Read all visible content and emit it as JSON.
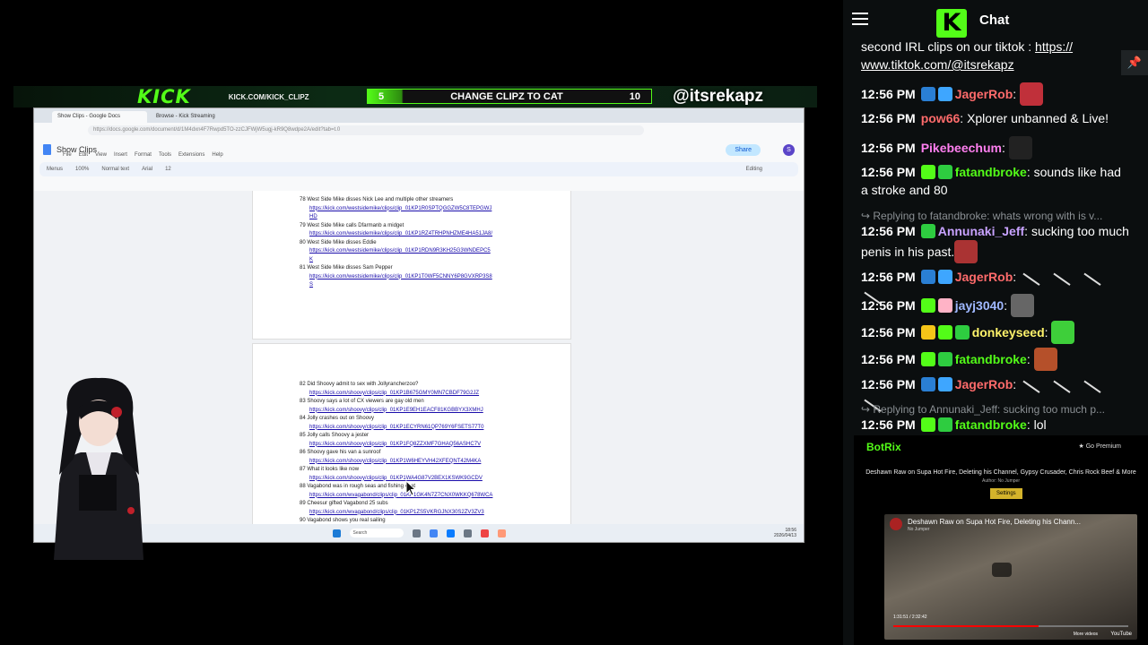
{
  "stream": {
    "overlay": {
      "logo": "KICK",
      "url": "KICK.COM/KICK_CLIPZ",
      "goal_left": "5",
      "goal_text": "CHANGE CLIPZ TO CAT",
      "goal_right": "10",
      "handle": "@itsrekapz"
    },
    "browser": {
      "tabs": [
        "Show Clips - Google Docs",
        "Browse - Kick Streaming"
      ],
      "url": "https://docs.google.com/document/d/1M4dxn4F7Rwpd5TO-zzCJFWjW5ugj-kR9Q8wdpe2A/edit?tab=t.0",
      "doc_title": "Show Clips",
      "menu": [
        "File",
        "Edit",
        "View",
        "Insert",
        "Format",
        "Tools",
        "Extensions",
        "Help"
      ],
      "toolbar": [
        "Menus",
        "100%",
        "Normal text",
        "Arial",
        "12",
        "Editing"
      ],
      "share_label": "Share",
      "avatar": "S",
      "page1_lines": [
        {
          "text": "78 West Side Mike disses Nick Lee and multiple other streamers",
          "link": false
        },
        {
          "text": "https://kick.com/westsidemike/clips/clip_01KP1R0SPTQGGZW5C8TEPGWJ",
          "link": true
        },
        {
          "text": "HD",
          "link": true
        },
        {
          "text": "79 West Side Mike calls Dfarmanb a midget",
          "link": false
        },
        {
          "text": "https://kick.com/westsidemike/clips/clip_01KP1RZ4TRHPNHZME4HA51JA8/",
          "link": true
        },
        {
          "text": "80 West Side Mike disses Eddie",
          "link": false
        },
        {
          "text": "https://kick.com/westsidemike/clips/clip_01KP1RDN9R3KH25G3WNDEPC5",
          "link": true
        },
        {
          "text": "K",
          "link": true
        },
        {
          "text": "81 West Side Mike disses Sam Pepper",
          "link": false
        },
        {
          "text": "https://kick.com/westsidemike/clips/clip_01KP1T0WF5CNNY6P8GVXRP3S8",
          "link": true
        },
        {
          "text": "S",
          "link": true
        }
      ],
      "page2_lines": [
        {
          "text": "82 Did Shoovy admit to sex with Jollyrancherzoo?",
          "link": false
        },
        {
          "text": "https://kick.com/shoovy/clips/clip_01KP1B675GMY0MN7CBDF79G2JZ",
          "link": true
        },
        {
          "text": "83 Shoovy says a lot of CX viewers are gay old men",
          "link": false
        },
        {
          "text": "https://kick.com/shoovy/clips/clip_01KP1E9EH1EACF81KGBBYX3XMHJ",
          "link": true
        },
        {
          "text": "84 Jolly crashes out on Shoovy",
          "link": false
        },
        {
          "text": "https://kick.com/shoovy/clips/clip_01KP1ECYRN61QP769Y6FSETS77T0",
          "link": true
        },
        {
          "text": "85 Jolly calls Shoovy a jester",
          "link": false
        },
        {
          "text": "https://kick.com/shoovy/clips/clip_01KP1FQ8ZZXMF7GHAQ56ASHC7V",
          "link": true
        },
        {
          "text": "86 Shoovy gave his van a sunroof",
          "link": false
        },
        {
          "text": "https://kick.com/shoovy/clips/clip_01KP1W6HEYVH42XFEQNT42M4KA",
          "link": true
        },
        {
          "text": "87 What it looks like now",
          "link": false
        },
        {
          "text": "https://kick.com/shoovy/clips/clip_01KP1WA4G87V2BEX1KSWK9GCDV",
          "link": true
        },
        {
          "text": "88 Vagabond was in rough seas and fishing chat",
          "link": false
        },
        {
          "text": "https://kick.com/wvagabond/clips/clip_01KP1GK4N7Z7CNX0WKKQ678WCA",
          "link": true
        },
        {
          "text": "89 Cheesur gifted Vagabond 25 subs",
          "link": false
        },
        {
          "text": "https://kick.com/wvagabond/clips/clip_01KP1ZS5VKRGJNX30S2ZV3ZV3",
          "link": true
        },
        {
          "text": "90 Vagabond shows you real sailing",
          "link": false
        }
      ],
      "taskbar": {
        "search": "Search",
        "time": "18:56",
        "date": "2026/04/13"
      }
    }
  },
  "chat": {
    "title": "Chat",
    "logo": "K",
    "pin": "📌",
    "top_text_1": "second IRL clips on our tiktok : ",
    "top_link_1": "https://",
    "top_link_2": "www.tiktok.com/@itsrekapz",
    "messages": [
      {
        "time": "12:56 PM",
        "user": "JagerRob",
        "color": "#ff6b6b",
        "text": "",
        "badges": [
          "#2a7fd4",
          "#3ea6ff"
        ],
        "emote": "#c0303a"
      },
      {
        "time": "12:56 PM",
        "user": "pow66",
        "color": "#ff6b6b",
        "text": "Xplorer unbanned & Live!",
        "badges": [],
        "emote": ""
      },
      {
        "time": "12:56 PM",
        "user": "Pikebeechum",
        "color": "#ff7ff0",
        "text": "",
        "badges": [],
        "emote": "#222"
      },
      {
        "time": "12:56 PM",
        "user": "fatandbroke",
        "color": "#53fc18",
        "text": "sounds like had a stroke and 80",
        "badges": [
          "#53fc18",
          "#2ecc40"
        ],
        "emote": ""
      },
      {
        "time": "",
        "user": "",
        "color": "",
        "text": "Replying to fatandbroke: whats wrong with is v...",
        "badges": [],
        "emote": "",
        "reply": true
      },
      {
        "time": "12:56 PM",
        "user": "Annunaki_Jeff",
        "color": "#c8a2ff",
        "text": "sucking too much penis in his past.",
        "badges": [
          "#2ecc40"
        ],
        "emote": "#a33"
      },
      {
        "time": "12:56 PM",
        "user": "JagerRob",
        "color": "#ff6b6b",
        "text": "",
        "badges": [
          "#2a7fd4",
          "#3ea6ff"
        ],
        "emote": "",
        "slashes": 4
      },
      {
        "time": "12:56 PM",
        "user": "jayj3040",
        "color": "#9fb8ff",
        "text": "",
        "badges": [
          "#53fc18",
          "#ffb3c6"
        ],
        "emote": "#666"
      },
      {
        "time": "12:56 PM",
        "user": "donkeyseed",
        "color": "#fff36b",
        "text": "",
        "badges": [
          "#f5c518",
          "#53fc18",
          "#2ecc40"
        ],
        "emote": "#3ecf3a"
      },
      {
        "time": "12:56 PM",
        "user": "fatandbroke",
        "color": "#53fc18",
        "text": "",
        "badges": [
          "#53fc18",
          "#2ecc40"
        ],
        "emote": "#b5502a"
      },
      {
        "time": "12:56 PM",
        "user": "JagerRob",
        "color": "#ff6b6b",
        "text": "",
        "badges": [
          "#2a7fd4",
          "#3ea6ff"
        ],
        "emote": "",
        "slashes": 4
      },
      {
        "time": "",
        "user": "",
        "color": "",
        "text": "Replying to Annunaki_Jeff: sucking too much p...",
        "badges": [],
        "emote": "",
        "reply": true
      },
      {
        "time": "12:56 PM",
        "user": "fatandbroke",
        "color": "#53fc18",
        "text": "lol",
        "badges": [
          "#53fc18",
          "#2ecc40"
        ],
        "emote": ""
      }
    ]
  },
  "botrix": {
    "title": "BotRix",
    "premium": "★ Go Premium",
    "video_heading": "Deshawn Raw on Supa Hot Fire, Deleting his Channel, Gypsy Crusader, Chris Rock Beef & More",
    "author_label": "Author: No Jumper",
    "settings_label": "Settings",
    "video_title": "Deshawn Raw on Supa Hot Fire, Deleting his Chann...",
    "video_channel": "No Jumper",
    "video_time": "1:31:51 / 2:32:42",
    "more_videos": "More videos",
    "youtube": "YouTube",
    "progress": 0.62
  }
}
